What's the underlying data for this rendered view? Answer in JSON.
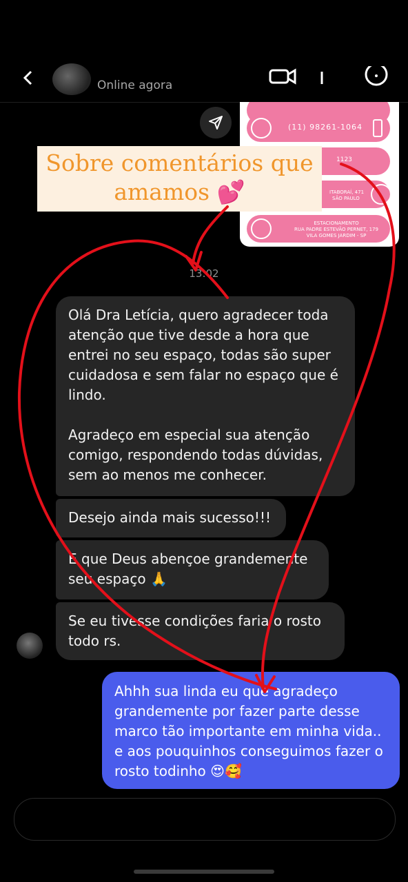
{
  "header": {
    "status": "Online agora"
  },
  "card": {
    "phone": "(11) 98261-1064",
    "partial_text": "1123",
    "address_line1": "ITABORAÍ, 471",
    "address_line2": "SÃO PAULO",
    "parking_line1": "ESTACIONAMENTO",
    "parking_line2": "RUA PADRE ESTEVÃO PERNET, 179",
    "parking_line3": "VILA GOMES JARDIM - SP"
  },
  "banner": {
    "line1": "Sobre comentários que",
    "line2": "amamos 💕"
  },
  "timestamp": "13:02",
  "messages": {
    "m1_p1": "Olá Dra Letícia, quero agradecer toda atenção que tive desde a hora que entrei no seu espaço, todas são super cuidadosa e sem falar no espaço que é lindo.",
    "m1_p2": "Agradeço em especial sua atenção comigo, respondendo todas dúvidas, sem ao menos me conhecer.",
    "m2": "Desejo ainda mais sucesso!!!",
    "m3": "E que Deus abençoe grandemente seu espaço 🙏",
    "m4": "Se eu tivesse condições faria o rosto todo rs.",
    "reply": "Ahhh sua linda eu que agradeço grandemente por fazer parte desse marco tão importante em minha vida.. e aos pouquinhos conseguimos fazer o rosto todinho 😍🥰"
  },
  "icons": {
    "back": "chevron-left-icon",
    "share": "paper-plane-icon",
    "whatsapp": "whatsapp-icon",
    "phone": "smartphone-icon",
    "waze": "waze-icon"
  },
  "colors": {
    "background": "#000000",
    "received_bubble": "#262626",
    "sent_bubble": "#4a5cec",
    "banner_bg": "#fdf0e0",
    "banner_text": "#f0962c",
    "card_pink": "#f07aa3",
    "heart_red": "#e3101a"
  }
}
